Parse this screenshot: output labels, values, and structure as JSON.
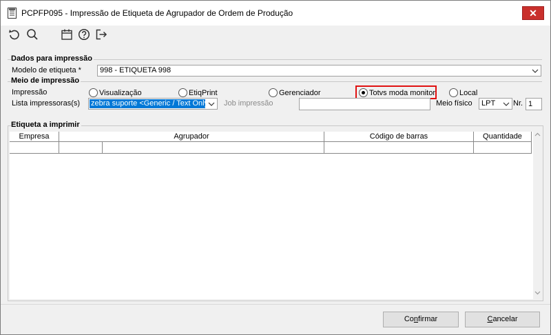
{
  "window": {
    "title": "PCPFP095 - Impressão de Etiqueta de Agrupador de Ordem de Produção",
    "close_label": "✕"
  },
  "toolbar": {
    "icons": [
      "undo-icon",
      "search-icon",
      "calendar-icon",
      "help-icon",
      "exit-icon"
    ]
  },
  "dados": {
    "group_title": "Dados para impressão",
    "modelo_label": "Modelo de etiqueta *",
    "modelo_value": "998 - ETIQUETA 998"
  },
  "meio": {
    "group_title": "Meio de impressão",
    "impressao_label": "Impressão",
    "options": [
      {
        "label": "Visualização",
        "checked": false
      },
      {
        "label": "EtiqPrint",
        "checked": false
      },
      {
        "label": "Gerenciador",
        "checked": false
      },
      {
        "label": "Totvs moda monitor",
        "checked": true
      },
      {
        "label": "Local",
        "checked": false
      }
    ],
    "lista_label": "Lista impressoras(s)",
    "lista_value": "zebra suporte <Generic / Text Only",
    "job_label": "Job impressão",
    "job_value": "",
    "meio_fisico_label": "Meio físico",
    "meio_fisico_value": "LPT",
    "nr_label": "Nr.",
    "nr_value": "1"
  },
  "etiqueta": {
    "group_title": "Etiqueta a imprimir",
    "columns": [
      "Empresa",
      "Agrupador",
      "Código de barras",
      "Quantidade"
    ]
  },
  "buttons": {
    "confirm_prefix": "Co",
    "confirm_underlined": "n",
    "confirm_suffix": "firmar",
    "cancel_underlined": "C",
    "cancel_suffix": "ancelar"
  },
  "colors": {
    "background": "#f0f0f0",
    "close_button": "#c9302c",
    "selection": "#0078d7",
    "highlight": "#e01010"
  }
}
